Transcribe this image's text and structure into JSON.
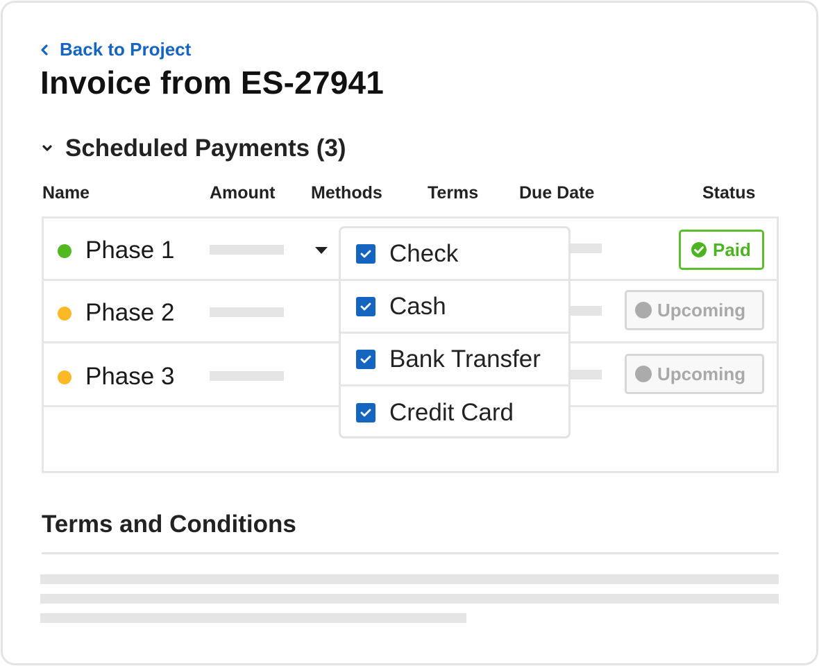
{
  "nav": {
    "back_label": "Back to Project"
  },
  "page": {
    "title": "Invoice from ES-27941"
  },
  "scheduled_payments": {
    "section_label": "Scheduled Payments (3)",
    "count": 3,
    "expanded": true,
    "columns": [
      "Name",
      "Amount",
      "Methods",
      "Terms",
      "Due Date",
      "Status"
    ],
    "rows": [
      {
        "name": "Phase 1",
        "indicator_color": "#52b81f",
        "status": "Paid",
        "status_icon": "check-circle-icon"
      },
      {
        "name": "Phase 2",
        "indicator_color": "#fbb928",
        "status": "Upcoming",
        "status_icon": "circle-icon"
      },
      {
        "name": "Phase 3",
        "indicator_color": "#fbb928",
        "status": "Upcoming",
        "status_icon": "circle-icon"
      }
    ]
  },
  "methods_dropdown": {
    "open": true,
    "options": [
      {
        "label": "Check",
        "checked": true
      },
      {
        "label": "Cash",
        "checked": true
      },
      {
        "label": "Bank Transfer",
        "checked": true
      },
      {
        "label": "Credit Card",
        "checked": true
      }
    ]
  },
  "terms_section": {
    "title": "Terms and Conditions"
  },
  "colors": {
    "link": "#1565c0",
    "paid": "#4cb321",
    "upcoming": "#a9a9a9",
    "checkbox": "#1565c0",
    "placeholder": "#e5e5e5",
    "border": "#e3e3e3"
  }
}
